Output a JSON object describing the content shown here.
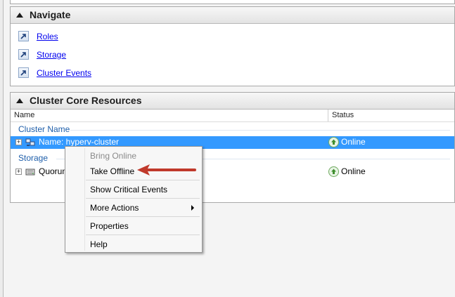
{
  "navigate": {
    "title": "Navigate",
    "links": [
      {
        "label": "Roles"
      },
      {
        "label": "Storage"
      },
      {
        "label": "Cluster Events"
      }
    ]
  },
  "core": {
    "title": "Cluster Core Resources",
    "columns": {
      "name": "Name",
      "status": "Status"
    },
    "groups": [
      {
        "label": "Cluster Name",
        "rows": [
          {
            "name": "Name: hyperv-cluster",
            "status": "Online",
            "selected": true
          }
        ]
      },
      {
        "label": "Storage",
        "rows": [
          {
            "name": "Quorum",
            "status": "Online",
            "selected": false
          }
        ]
      }
    ]
  },
  "context_menu": {
    "items": [
      {
        "label": "Bring Online",
        "enabled": false
      },
      {
        "label": "Take Offline",
        "enabled": true
      },
      {
        "label": "Show Critical Events",
        "enabled": true
      },
      {
        "label": "More Actions",
        "enabled": true,
        "submenu": true
      },
      {
        "label": "Properties",
        "enabled": true
      },
      {
        "label": "Help",
        "enabled": true
      }
    ]
  },
  "colors": {
    "selection": "#3399ff",
    "annotation_arrow": "#c0392b",
    "link": "#0000ee",
    "group_label": "#1e5eaa"
  },
  "icons": [
    "collapse-triangle-icon",
    "shortcut-arrow-icon",
    "expander-plus-icon",
    "cluster-name-icon",
    "disk-icon",
    "online-status-icon",
    "submenu-arrow-icon"
  ]
}
